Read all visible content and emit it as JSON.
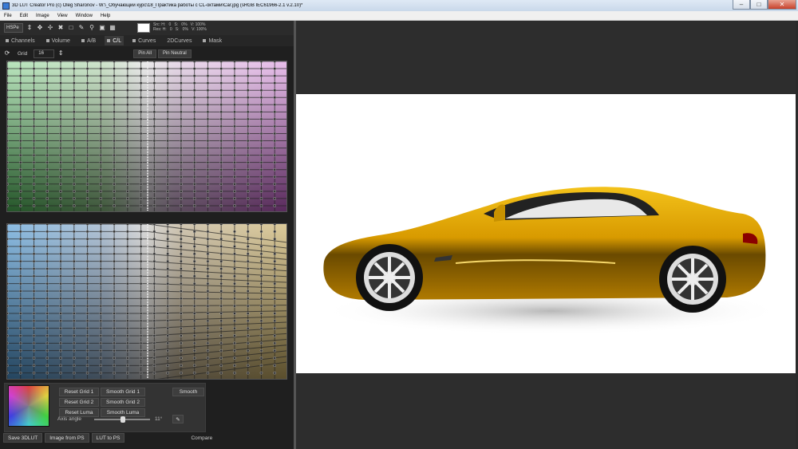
{
  "window": {
    "title": "3D LUT Creator Pro (c) Oleg Sharonov - W:\\_Обучающий курс\\18_Практика работы с CL-октами\\Car.jpg (sRGB IEC61966-2.1 v.2.10)*",
    "controls": [
      "minimize",
      "maximize",
      "close"
    ]
  },
  "menu": [
    "File",
    "Edit",
    "Image",
    "View",
    "Window",
    "Help"
  ],
  "toolbar": {
    "mode": "HSPe",
    "readout_line1": "Src: H:   0   S:   0%   V: 100%",
    "readout_line2": "Res: H:   0   S:   0%   V: 100%",
    "icons": [
      "move-icon",
      "pan-icon",
      "scale-icon",
      "select-icon",
      "eyedropper-icon",
      "zoom-icon",
      "fit-icon",
      "grid-icon"
    ]
  },
  "tabs": [
    "Channels",
    "Volume",
    "A/B",
    "C/L",
    "Curves",
    "2DCurves",
    "Mask"
  ],
  "active_tab": "C/L",
  "grid": {
    "label": "Grid",
    "value": "16",
    "pin_all": "Pin All",
    "pin_neutral": "Pin Neutral"
  },
  "controls": {
    "reset_grid1": "Reset Grid 1",
    "smooth_grid1": "Smooth Grid 1",
    "reset_grid2": "Reset Grid 2",
    "smooth_grid2": "Smooth Grid 2",
    "reset_luma": "Reset Luma",
    "smooth_luma": "Smooth Luma",
    "smooth": "Smooth",
    "axis_angle_label": "Axis angle",
    "axis_angle_value": "11°",
    "axis_angle_fraction": 0.52
  },
  "footer": {
    "save": "Save 3DLUT",
    "image_from_ps": "Image from PS",
    "lut_to_ps": "LUT to PS",
    "compare": "Compare"
  },
  "colors": {
    "car_body": "#e0a000",
    "panel_bg": "#1f1f1f",
    "viewer_bg": "#2d2d2d"
  }
}
